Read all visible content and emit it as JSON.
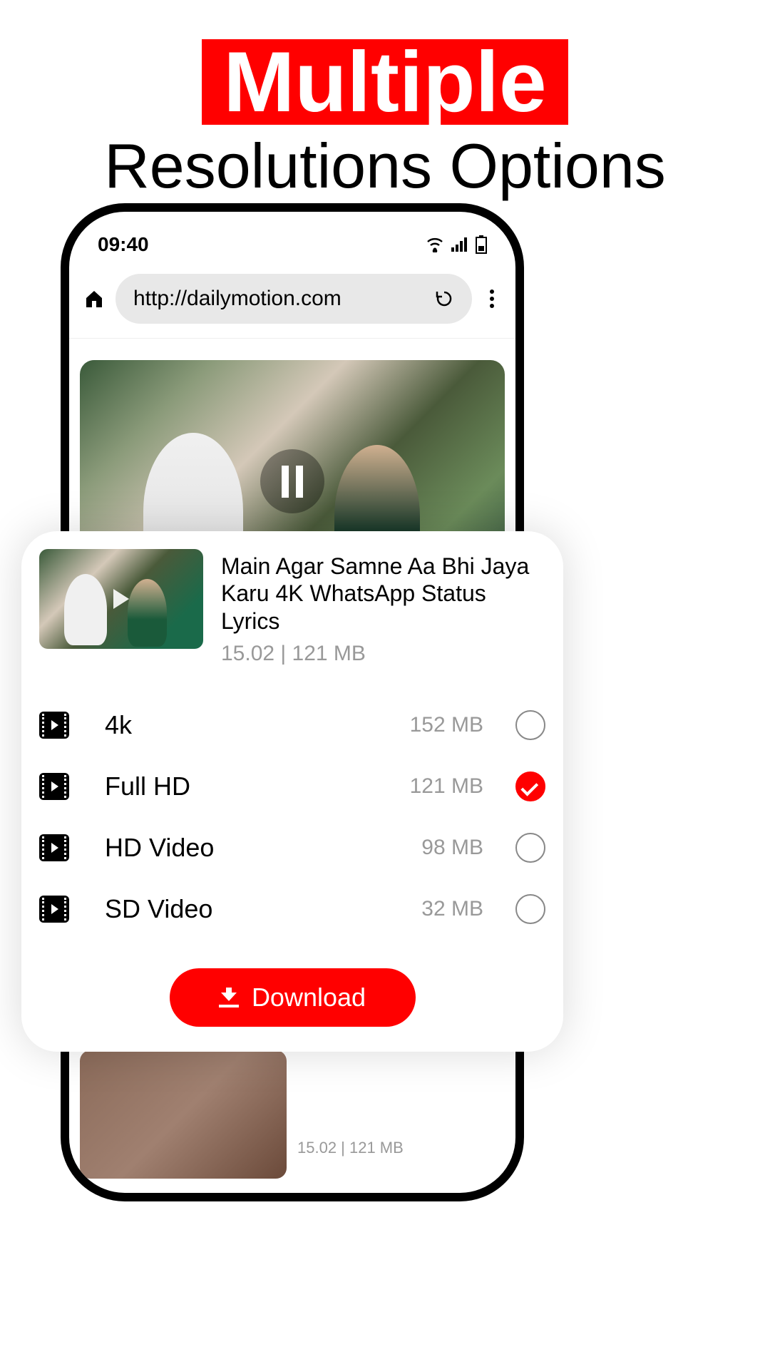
{
  "headline": {
    "red": "Multiple",
    "black": "Resolutions Options"
  },
  "status": {
    "time": "09:40"
  },
  "browser": {
    "url": "http://dailymotion.com"
  },
  "card_below_meta": "15.02 | 121 MB",
  "sheet": {
    "title": "Main Agar Samne Aa Bhi Jaya Karu 4K WhatsApp Status Lyrics",
    "meta": "15.02 | 121 MB",
    "options": [
      {
        "label": "4k",
        "size": "152 MB",
        "selected": false
      },
      {
        "label": "Full HD",
        "size": "121 MB",
        "selected": true
      },
      {
        "label": "HD Video",
        "size": "98 MB",
        "selected": false
      },
      {
        "label": "SD Video",
        "size": "32 MB",
        "selected": false
      }
    ],
    "download_label": "Download"
  }
}
